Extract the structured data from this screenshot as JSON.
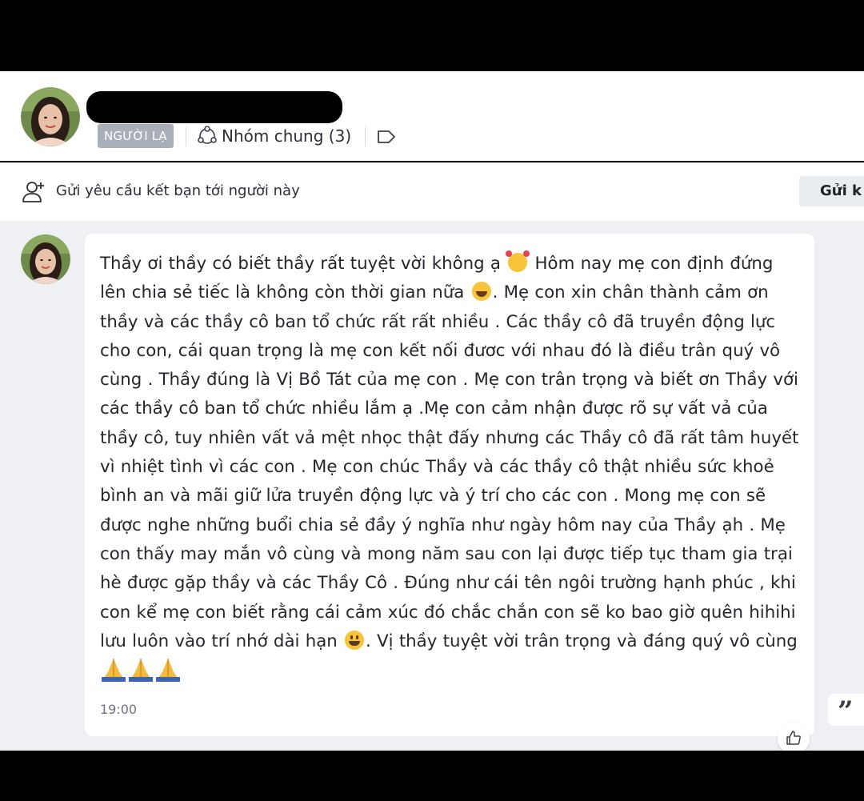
{
  "header": {
    "badge": "NGƯỜI LẠ",
    "group_label": "Nhóm chung (3)",
    "icons": [
      "avatar",
      "group-icon",
      "tag-icon"
    ]
  },
  "friend_request": {
    "text": "Gửi yêu cầu kết bạn tới người này",
    "button_label": "Gửi k"
  },
  "message": {
    "lines": [
      "Thầy ơi thầy có biết thầy rất tuyệt vời không ạ",
      "Hôm nay mẹ con định đứng",
      "lên chia sẻ tiếc là không còn thời gian nữa",
      ". Mẹ con xin chân thành cảm ơn",
      "thầy và các thầy cô ban tổ chức rất rất nhiều . Các thầy cô đã truyền động lực",
      "cho con, cái quan trọng là mẹ con kết nối đươc với nhau đó là điều trân quý vô",
      "cùng . Thầy đúng là Vị Bồ Tát của mẹ con . Mẹ con trân trọng và biết ơn Thầy với",
      "các thầy cô ban tổ chức nhiều lắm ạ .Mẹ con cảm nhận được rõ sự vất vả của",
      "thầy cô, tuy nhiên vất vả mệt nhọc thật đấy nhưng các Thầy cô đã rất tâm huyết",
      "vì nhiệt tình vì các con . Mẹ con chúc Thầy và các thầy cô thật nhiều sức khoẻ",
      "bình an và mãi giữ lửa truyền động lực và ý trí cho các con . Mong mẹ con sẽ",
      "được nghe những buổi chia sẻ đầy ý nghĩa như ngày hôm nay của Thầy ạh . Mẹ",
      "con thấy may mắn vô cùng và mong năm sau con lại được tiếp tục tham gia trại",
      "hè được gặp thầy và các Thầy Cô . Đúng như cái tên ngôi trường hạnh phúc , khi",
      "con kể mẹ con biết rằng cái cảm xúc đó chắc chắn con sẽ ko bao giờ quên hihihi",
      "lưu luôn vào trí nhớ dài hạn",
      ". Vị thầy tuyệt vời trân trọng và đáng quý vô cùng"
    ],
    "emojis": [
      "smiling-face-with-hearts",
      "laughing-face",
      "grinning-face",
      "folded-hands",
      "folded-hands",
      "folded-hands"
    ],
    "time": "19:00"
  },
  "actions": {
    "quote_symbol": "”",
    "like": "thumbs-up-icon"
  }
}
